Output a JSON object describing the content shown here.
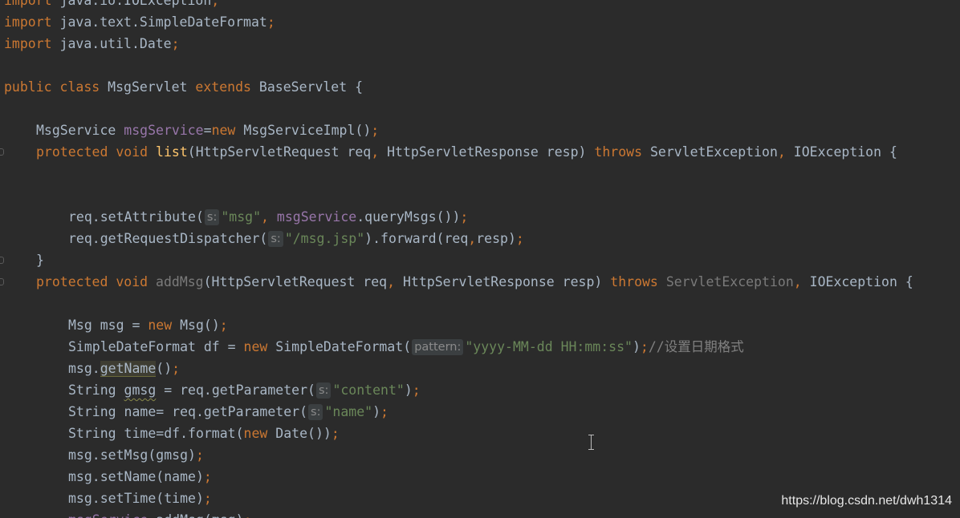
{
  "editor": {
    "background": "#2b2b2b",
    "colors": {
      "keyword": "#cc7832",
      "plain": "#a9b7c6",
      "string": "#6a8759",
      "field": "#9876aa",
      "method": "#ffc66d",
      "comment": "#808080",
      "hint": "#8a8a8a"
    },
    "lines": [
      {
        "indent": 0,
        "tokens": [
          [
            "keyword",
            "import "
          ],
          [
            "plain",
            "java.io.IOException"
          ],
          [
            "punct",
            ";"
          ]
        ]
      },
      {
        "indent": 0,
        "tokens": [
          [
            "keyword",
            "import "
          ],
          [
            "plain",
            "java.text.SimpleDateFormat"
          ],
          [
            "punct",
            ";"
          ]
        ]
      },
      {
        "indent": 0,
        "tokens": [
          [
            "keyword",
            "import "
          ],
          [
            "plain",
            "java.util.Date"
          ],
          [
            "punct",
            ";"
          ]
        ]
      },
      {
        "indent": 0,
        "tokens": []
      },
      {
        "indent": 0,
        "tokens": [
          [
            "keyword",
            "public class "
          ],
          [
            "plain",
            "MsgServlet "
          ],
          [
            "keyword",
            "extends "
          ],
          [
            "plain",
            "BaseServlet {"
          ]
        ]
      },
      {
        "indent": 0,
        "tokens": []
      },
      {
        "indent": 1,
        "tokens": [
          [
            "plain",
            "MsgService "
          ],
          [
            "field",
            "msgService"
          ],
          [
            "plain",
            "="
          ],
          [
            "keyword",
            "new "
          ],
          [
            "plain",
            "MsgServiceImpl()"
          ],
          [
            "punct",
            ";"
          ]
        ]
      },
      {
        "indent": 1,
        "fold": true,
        "tokens": [
          [
            "keyword",
            "protected void "
          ],
          [
            "method",
            "list"
          ],
          [
            "plain",
            "(HttpServletRequest req"
          ],
          [
            "punct",
            ", "
          ],
          [
            "plain",
            "HttpServletResponse resp) "
          ],
          [
            "keyword",
            "throws "
          ],
          [
            "plain",
            "ServletException"
          ],
          [
            "punct",
            ", "
          ],
          [
            "plain",
            "IOException {"
          ]
        ]
      },
      {
        "indent": 0,
        "tokens": []
      },
      {
        "indent": 0,
        "tokens": []
      },
      {
        "indent": 2,
        "tokens": [
          [
            "plain",
            "req.setAttribute("
          ],
          [
            "hint",
            "s:"
          ],
          [
            "string",
            "\"msg\""
          ],
          [
            "punct",
            ", "
          ],
          [
            "field",
            "msgService"
          ],
          [
            "plain",
            ".queryMsgs())"
          ],
          [
            "punct",
            ";"
          ]
        ]
      },
      {
        "indent": 2,
        "tokens": [
          [
            "plain",
            "req.getRequestDispatcher("
          ],
          [
            "hint",
            "s:"
          ],
          [
            "string",
            "\"/msg.jsp\""
          ],
          [
            "plain",
            ").forward(req"
          ],
          [
            "punct",
            ","
          ],
          [
            "plain",
            "resp)"
          ],
          [
            "punct",
            ";"
          ]
        ]
      },
      {
        "indent": 1,
        "fold": true,
        "tokens": [
          [
            "plain",
            "}"
          ]
        ]
      },
      {
        "indent": 1,
        "fold": true,
        "tokens": [
          [
            "keyword",
            "protected void "
          ],
          [
            "unused",
            "addMsg"
          ],
          [
            "plain",
            "(HttpServletRequest req"
          ],
          [
            "punct",
            ", "
          ],
          [
            "plain",
            "HttpServletResponse resp) "
          ],
          [
            "keyword",
            "throws "
          ],
          [
            "unused",
            "ServletException"
          ],
          [
            "punct",
            ", "
          ],
          [
            "plain",
            "IOException {"
          ]
        ]
      },
      {
        "indent": 0,
        "tokens": []
      },
      {
        "indent": 2,
        "tokens": [
          [
            "plain",
            "Msg msg = "
          ],
          [
            "keyword",
            "new "
          ],
          [
            "plain",
            "Msg()"
          ],
          [
            "punct",
            ";"
          ]
        ]
      },
      {
        "indent": 2,
        "tokens": [
          [
            "plain",
            "SimpleDateFormat df = "
          ],
          [
            "keyword",
            "new "
          ],
          [
            "plain",
            "SimpleDateFormat("
          ],
          [
            "hint",
            "pattern:"
          ],
          [
            "string",
            "\"yyyy-MM-dd HH:mm:ss\""
          ],
          [
            "plain",
            ")"
          ],
          [
            "punct",
            ";"
          ],
          [
            "comment",
            "//设置日期格式"
          ]
        ]
      },
      {
        "indent": 2,
        "tokens": [
          [
            "plain",
            "msg."
          ],
          [
            "highlight",
            "getName"
          ],
          [
            "plain",
            "()"
          ],
          [
            "punct",
            ";"
          ]
        ]
      },
      {
        "indent": 2,
        "tokens": [
          [
            "plain",
            "String "
          ],
          [
            "squiggle",
            "gmsg"
          ],
          [
            "plain",
            " = req.getParameter("
          ],
          [
            "hint",
            "s:"
          ],
          [
            "string",
            "\"content\""
          ],
          [
            "plain",
            ")"
          ],
          [
            "punct",
            ";"
          ]
        ]
      },
      {
        "indent": 2,
        "tokens": [
          [
            "plain",
            "String name= req.getParameter("
          ],
          [
            "hint",
            "s:"
          ],
          [
            "string",
            "\"name\""
          ],
          [
            "plain",
            ")"
          ],
          [
            "punct",
            ";"
          ]
        ]
      },
      {
        "indent": 2,
        "tokens": [
          [
            "plain",
            "String time=df.format("
          ],
          [
            "keyword",
            "new "
          ],
          [
            "plain",
            "Date())"
          ],
          [
            "punct",
            ";"
          ]
        ]
      },
      {
        "indent": 2,
        "tokens": [
          [
            "plain",
            "msg.setMsg(gmsg)"
          ],
          [
            "punct",
            ";"
          ]
        ]
      },
      {
        "indent": 2,
        "tokens": [
          [
            "plain",
            "msg.setName(name)"
          ],
          [
            "punct",
            ";"
          ]
        ]
      },
      {
        "indent": 2,
        "tokens": [
          [
            "plain",
            "msg.setTime(time)"
          ],
          [
            "punct",
            ";"
          ]
        ]
      },
      {
        "indent": 2,
        "tokens": [
          [
            "field",
            "msgService"
          ],
          [
            "plain",
            ".addMsg(msg)"
          ],
          [
            "punct",
            ";"
          ]
        ]
      }
    ]
  },
  "watermark": "https://blog.csdn.net/dwh1314"
}
